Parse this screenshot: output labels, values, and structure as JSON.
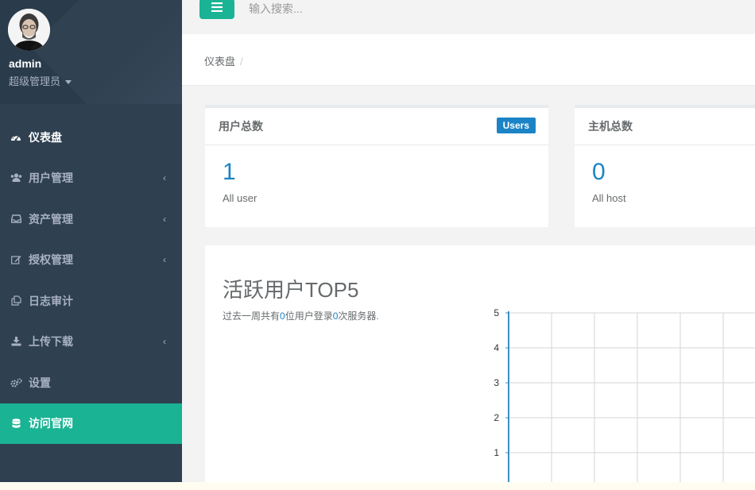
{
  "sidebar": {
    "profile": {
      "name": "admin",
      "role": "超级管理员"
    },
    "items": [
      {
        "label": "仪表盘",
        "icon": "dashboard-icon",
        "arrow": "",
        "state": "active"
      },
      {
        "label": "用户管理",
        "icon": "users-icon",
        "arrow": "‹",
        "state": "normal"
      },
      {
        "label": "资产管理",
        "icon": "inbox-icon",
        "arrow": "‹",
        "state": "normal"
      },
      {
        "label": "授权管理",
        "icon": "edit-icon",
        "arrow": "‹",
        "state": "normal"
      },
      {
        "label": "日志审计",
        "icon": "copy-icon",
        "arrow": "",
        "state": "normal"
      },
      {
        "label": "上传下载",
        "icon": "download-icon",
        "arrow": "‹",
        "state": "normal"
      },
      {
        "label": "设置",
        "icon": "gears-icon",
        "arrow": "",
        "state": "normal"
      },
      {
        "label": "访问官网",
        "icon": "database-icon",
        "arrow": "",
        "state": "highlight"
      }
    ]
  },
  "topbar": {
    "search_placeholder": "输入搜索..."
  },
  "breadcrumb": {
    "current": "仪表盘",
    "separator": "/"
  },
  "cards": [
    {
      "title": "用户总数",
      "badge": "Users",
      "value": "1",
      "subtitle": "All user"
    },
    {
      "title": "主机总数",
      "badge": "",
      "value": "0",
      "subtitle": "All host"
    }
  ],
  "panel": {
    "title": "活跃用户TOP5",
    "desc_prefix": "过去一周共有",
    "desc_users": "0",
    "desc_mid": "位用户登录",
    "desc_count": "0",
    "desc_suffix": "次服务器."
  },
  "chart_data": {
    "type": "bar",
    "categories": [],
    "values": [],
    "y_ticks": [
      "5",
      "4",
      "3",
      "2",
      "1"
    ],
    "ylim": [
      0,
      5
    ],
    "grid": true
  },
  "colors": {
    "sidebar_bg": "#2f4050",
    "accent_green": "#1ab394",
    "accent_blue": "#1c84c6",
    "text": "#676a6c"
  }
}
